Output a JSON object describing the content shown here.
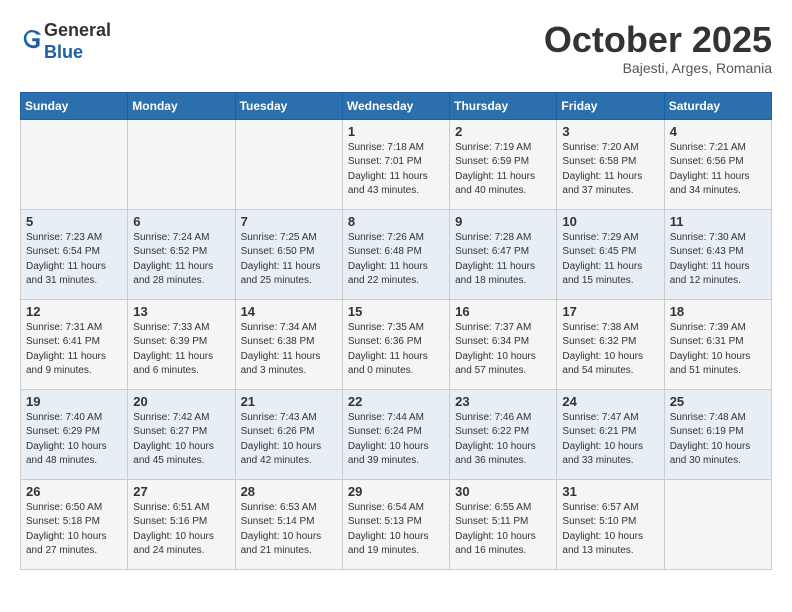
{
  "logo": {
    "general": "General",
    "blue": "Blue"
  },
  "title": "October 2025",
  "location": "Bajesti, Arges, Romania",
  "days_of_week": [
    "Sunday",
    "Monday",
    "Tuesday",
    "Wednesday",
    "Thursday",
    "Friday",
    "Saturday"
  ],
  "weeks": [
    [
      {
        "day": "",
        "info": ""
      },
      {
        "day": "",
        "info": ""
      },
      {
        "day": "",
        "info": ""
      },
      {
        "day": "1",
        "info": "Sunrise: 7:18 AM\nSunset: 7:01 PM\nDaylight: 11 hours and 43 minutes."
      },
      {
        "day": "2",
        "info": "Sunrise: 7:19 AM\nSunset: 6:59 PM\nDaylight: 11 hours and 40 minutes."
      },
      {
        "day": "3",
        "info": "Sunrise: 7:20 AM\nSunset: 6:58 PM\nDaylight: 11 hours and 37 minutes."
      },
      {
        "day": "4",
        "info": "Sunrise: 7:21 AM\nSunset: 6:56 PM\nDaylight: 11 hours and 34 minutes."
      }
    ],
    [
      {
        "day": "5",
        "info": "Sunrise: 7:23 AM\nSunset: 6:54 PM\nDaylight: 11 hours and 31 minutes."
      },
      {
        "day": "6",
        "info": "Sunrise: 7:24 AM\nSunset: 6:52 PM\nDaylight: 11 hours and 28 minutes."
      },
      {
        "day": "7",
        "info": "Sunrise: 7:25 AM\nSunset: 6:50 PM\nDaylight: 11 hours and 25 minutes."
      },
      {
        "day": "8",
        "info": "Sunrise: 7:26 AM\nSunset: 6:48 PM\nDaylight: 11 hours and 22 minutes."
      },
      {
        "day": "9",
        "info": "Sunrise: 7:28 AM\nSunset: 6:47 PM\nDaylight: 11 hours and 18 minutes."
      },
      {
        "day": "10",
        "info": "Sunrise: 7:29 AM\nSunset: 6:45 PM\nDaylight: 11 hours and 15 minutes."
      },
      {
        "day": "11",
        "info": "Sunrise: 7:30 AM\nSunset: 6:43 PM\nDaylight: 11 hours and 12 minutes."
      }
    ],
    [
      {
        "day": "12",
        "info": "Sunrise: 7:31 AM\nSunset: 6:41 PM\nDaylight: 11 hours and 9 minutes."
      },
      {
        "day": "13",
        "info": "Sunrise: 7:33 AM\nSunset: 6:39 PM\nDaylight: 11 hours and 6 minutes."
      },
      {
        "day": "14",
        "info": "Sunrise: 7:34 AM\nSunset: 6:38 PM\nDaylight: 11 hours and 3 minutes."
      },
      {
        "day": "15",
        "info": "Sunrise: 7:35 AM\nSunset: 6:36 PM\nDaylight: 11 hours and 0 minutes."
      },
      {
        "day": "16",
        "info": "Sunrise: 7:37 AM\nSunset: 6:34 PM\nDaylight: 10 hours and 57 minutes."
      },
      {
        "day": "17",
        "info": "Sunrise: 7:38 AM\nSunset: 6:32 PM\nDaylight: 10 hours and 54 minutes."
      },
      {
        "day": "18",
        "info": "Sunrise: 7:39 AM\nSunset: 6:31 PM\nDaylight: 10 hours and 51 minutes."
      }
    ],
    [
      {
        "day": "19",
        "info": "Sunrise: 7:40 AM\nSunset: 6:29 PM\nDaylight: 10 hours and 48 minutes."
      },
      {
        "day": "20",
        "info": "Sunrise: 7:42 AM\nSunset: 6:27 PM\nDaylight: 10 hours and 45 minutes."
      },
      {
        "day": "21",
        "info": "Sunrise: 7:43 AM\nSunset: 6:26 PM\nDaylight: 10 hours and 42 minutes."
      },
      {
        "day": "22",
        "info": "Sunrise: 7:44 AM\nSunset: 6:24 PM\nDaylight: 10 hours and 39 minutes."
      },
      {
        "day": "23",
        "info": "Sunrise: 7:46 AM\nSunset: 6:22 PM\nDaylight: 10 hours and 36 minutes."
      },
      {
        "day": "24",
        "info": "Sunrise: 7:47 AM\nSunset: 6:21 PM\nDaylight: 10 hours and 33 minutes."
      },
      {
        "day": "25",
        "info": "Sunrise: 7:48 AM\nSunset: 6:19 PM\nDaylight: 10 hours and 30 minutes."
      }
    ],
    [
      {
        "day": "26",
        "info": "Sunrise: 6:50 AM\nSunset: 5:18 PM\nDaylight: 10 hours and 27 minutes."
      },
      {
        "day": "27",
        "info": "Sunrise: 6:51 AM\nSunset: 5:16 PM\nDaylight: 10 hours and 24 minutes."
      },
      {
        "day": "28",
        "info": "Sunrise: 6:53 AM\nSunset: 5:14 PM\nDaylight: 10 hours and 21 minutes."
      },
      {
        "day": "29",
        "info": "Sunrise: 6:54 AM\nSunset: 5:13 PM\nDaylight: 10 hours and 19 minutes."
      },
      {
        "day": "30",
        "info": "Sunrise: 6:55 AM\nSunset: 5:11 PM\nDaylight: 10 hours and 16 minutes."
      },
      {
        "day": "31",
        "info": "Sunrise: 6:57 AM\nSunset: 5:10 PM\nDaylight: 10 hours and 13 minutes."
      },
      {
        "day": "",
        "info": ""
      }
    ]
  ]
}
